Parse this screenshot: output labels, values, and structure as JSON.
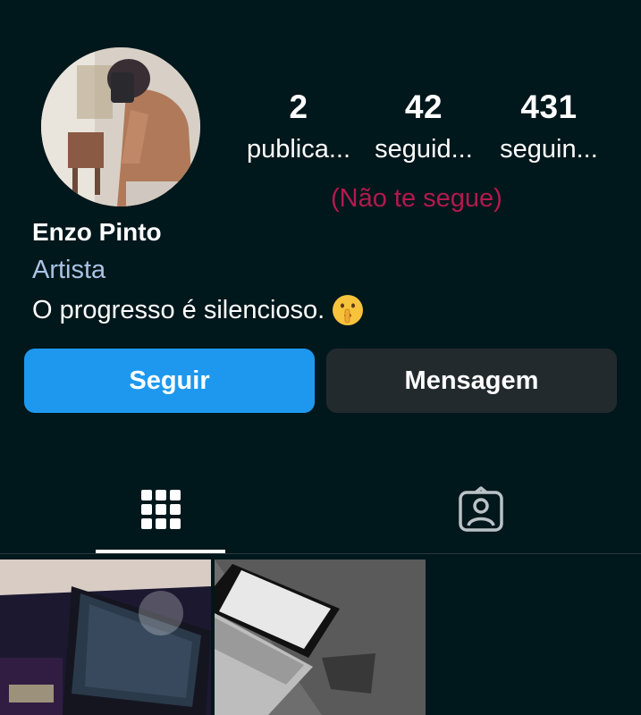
{
  "profile": {
    "name": "Enzo Pinto",
    "category": "Artista",
    "bio": "O progresso é silencioso.",
    "bio_emoji": "shushing-face-emoji"
  },
  "stats": [
    {
      "value": "2",
      "label": "publica..."
    },
    {
      "value": "42",
      "label": "seguid..."
    },
    {
      "value": "431",
      "label": "seguin..."
    }
  ],
  "follow_status": "(Não te segue)",
  "buttons": {
    "follow": "Seguir",
    "message": "Mensagem"
  },
  "tabs": [
    {
      "name": "grid",
      "icon": "grid-icon",
      "active": true
    },
    {
      "name": "tagged",
      "icon": "tagged-person-icon",
      "active": false
    }
  ],
  "colors": {
    "background": "#00171b",
    "follow_button": "#1e98ee",
    "message_button": "#232a2e",
    "not_following_text": "#b3194f",
    "category_text": "#a9c3e4"
  }
}
